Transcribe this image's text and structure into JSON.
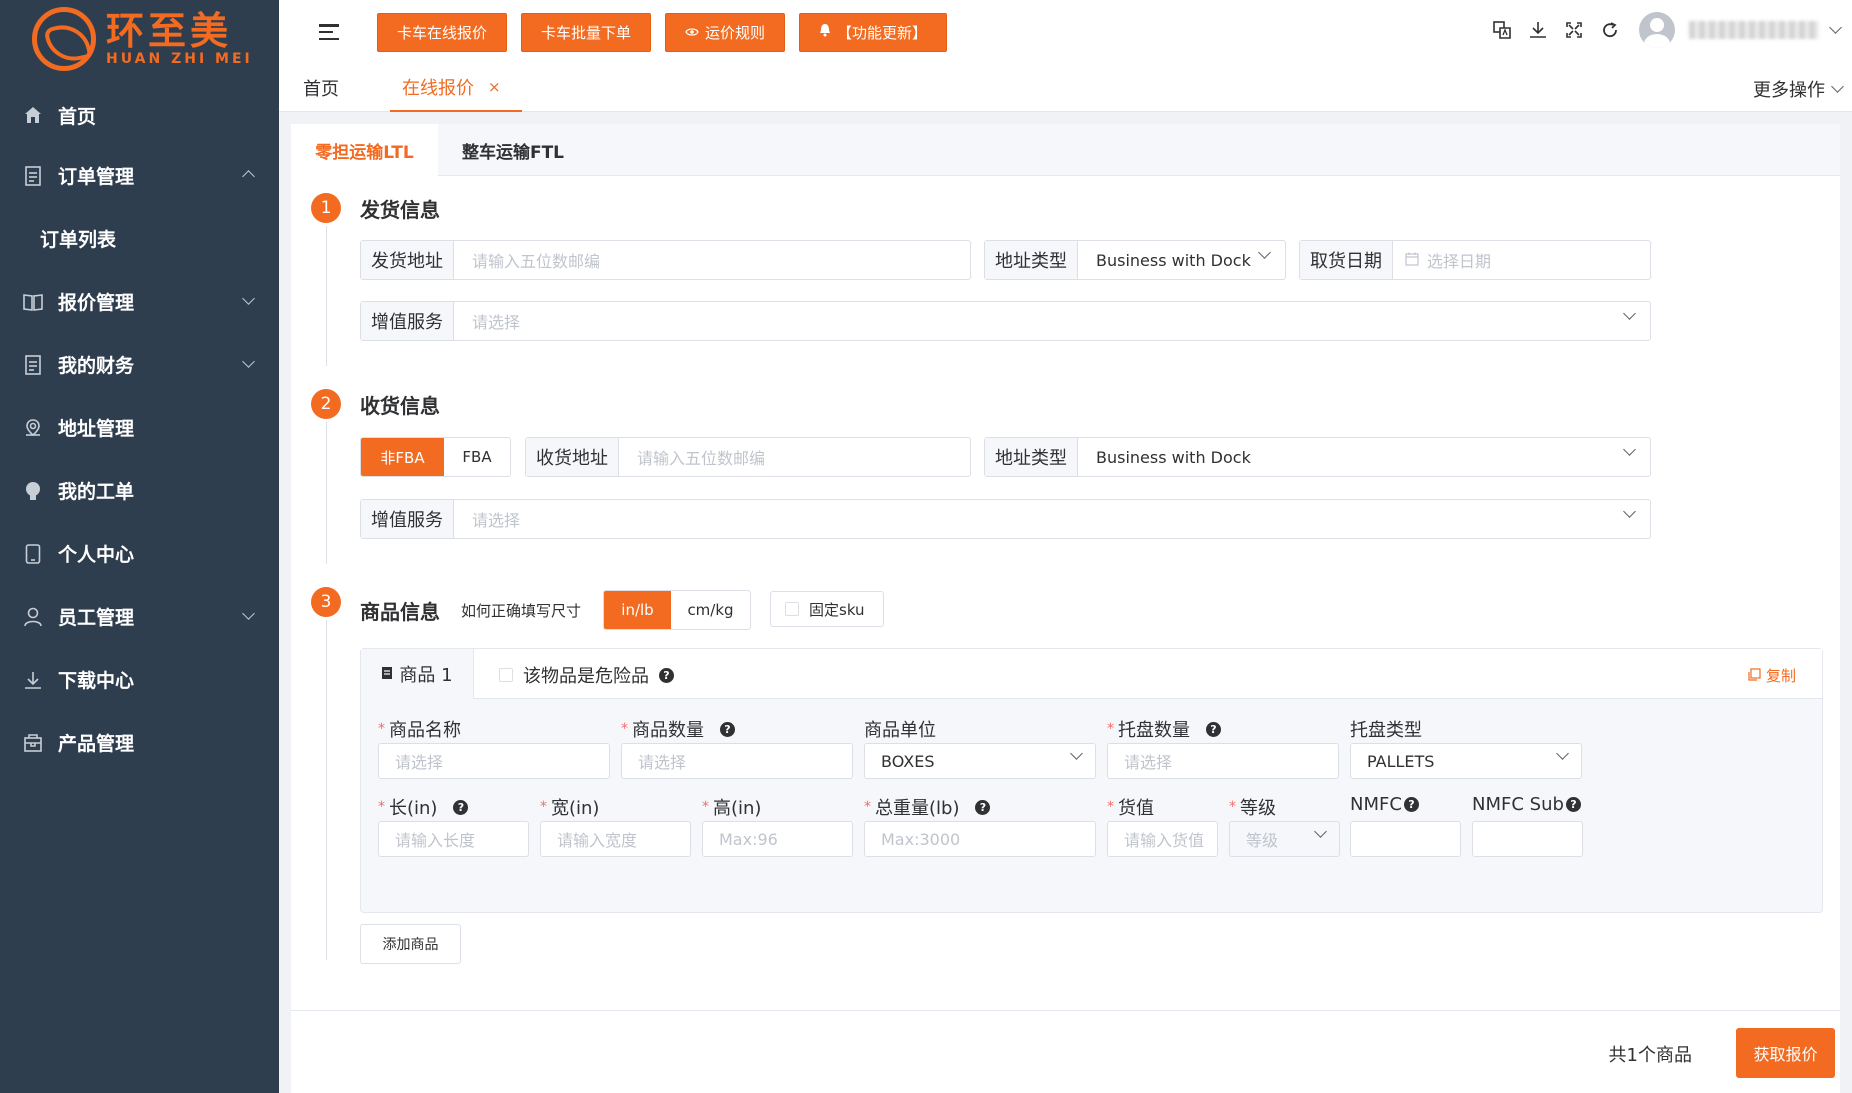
{
  "brand": {
    "cn": "环至美",
    "en": "HUAN ZHI MEI",
    "color": "#f26b21"
  },
  "sidebar": {
    "items": [
      {
        "label": "首页",
        "icon": "home-icon"
      },
      {
        "label": "订单管理",
        "icon": "document-icon",
        "expanded": true
      },
      {
        "label": "订单列表",
        "sub": true
      },
      {
        "label": "报价管理",
        "icon": "book-icon"
      },
      {
        "label": "我的财务",
        "icon": "document-icon"
      },
      {
        "label": "地址管理",
        "icon": "location-icon"
      },
      {
        "label": "我的工单",
        "icon": "bulb-icon"
      },
      {
        "label": "个人中心",
        "icon": "tablet-icon"
      },
      {
        "label": "员工管理",
        "icon": "user-icon"
      },
      {
        "label": "下载中心",
        "icon": "download-icon"
      },
      {
        "label": "产品管理",
        "icon": "box-icon"
      }
    ]
  },
  "header": {
    "buttons": [
      "卡车在线报价",
      "卡车批量下单",
      "运价规则",
      "【功能更新】"
    ]
  },
  "tabs": {
    "home": "首页",
    "active": "在线报价",
    "more": "更多操作"
  },
  "mode_tabs": [
    "零担运输LTL",
    "整车运输FTL"
  ],
  "ship": {
    "title": "发货信息",
    "address_label": "发货地址",
    "address_placeholder": "请输入五位数邮编",
    "addr_type_label": "地址类型",
    "addr_type_value": "Business with Dock",
    "date_label": "取货日期",
    "date_placeholder": "选择日期",
    "service_label": "增值服务",
    "service_placeholder": "请选择"
  },
  "receive": {
    "title": "收货信息",
    "seg": [
      "非FBA",
      "FBA"
    ],
    "address_label": "收货地址",
    "address_placeholder": "请输入五位数邮编",
    "addr_type_label": "地址类型",
    "addr_type_value": "Business with Dock",
    "service_label": "增值服务",
    "service_placeholder": "请选择"
  },
  "goods": {
    "title": "商品信息",
    "hint": "如何正确填写尺寸",
    "units": [
      "in/lb",
      "cm/kg"
    ],
    "fixed_sku": "固定sku",
    "tab": "商品 1",
    "danger": "该物品是危险品",
    "copy": "复制",
    "fields1": [
      {
        "label": "商品名称",
        "req": true,
        "ph": "请选择"
      },
      {
        "label": "商品数量",
        "req": true,
        "ph": "请选择",
        "q": true
      },
      {
        "label": "商品单位",
        "req": false,
        "value": "BOXES"
      },
      {
        "label": "托盘数量",
        "req": true,
        "ph": "请选择",
        "q": true
      },
      {
        "label": "托盘类型",
        "req": false,
        "value": "PALLETS"
      }
    ],
    "fields2": [
      {
        "label": "长(in)",
        "req": true,
        "ph": "请输入长度",
        "q": true
      },
      {
        "label": "宽(in)",
        "req": true,
        "ph": "请输入宽度"
      },
      {
        "label": "高(in)",
        "req": true,
        "ph": "Max:96"
      },
      {
        "label": "总重量(lb)",
        "req": true,
        "ph": "Max:3000",
        "q": true
      },
      {
        "label": "货值",
        "req": true,
        "ph": "请输入货值"
      },
      {
        "label": "等级",
        "req": true,
        "ph": "等级"
      },
      {
        "label": "NMFC",
        "req": false,
        "ph": ""
      },
      {
        "label": "NMFC Sub",
        "req": false,
        "ph": ""
      }
    ],
    "add": "添加商品"
  },
  "footer": {
    "total": "共1个商品",
    "submit": "获取报价"
  }
}
